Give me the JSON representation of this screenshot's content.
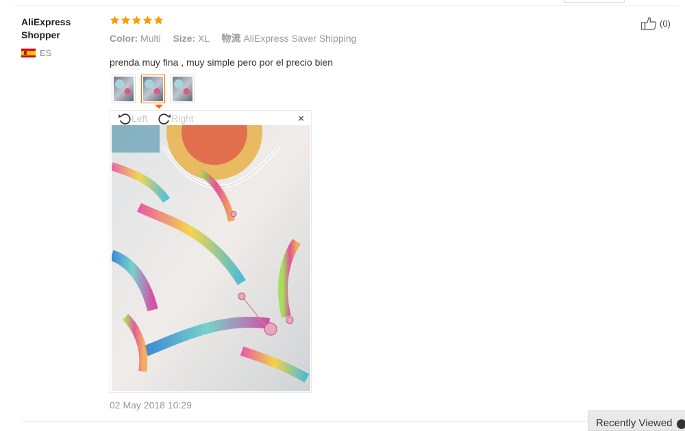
{
  "review": {
    "user_name": "AliExpress Shopper",
    "country_code": "ES",
    "rating": 5,
    "color_label": "Color:",
    "color_value": "Multi",
    "size_label": "Size:",
    "size_value": "XL",
    "shipping_label": "物流",
    "shipping_value": "AliExpress Saver Shipping",
    "text": "prenda muy fina , muy simple pero por el precio bien",
    "date": "02 May 2018 10:29",
    "helpful_count": "(0)"
  },
  "viewer": {
    "rotate_left": "Left",
    "rotate_right": "Right",
    "close": "×",
    "thumbnails": [
      "photo-1",
      "photo-2",
      "photo-3"
    ],
    "selected_index": 1
  },
  "recently_viewed": {
    "label": "Recently Viewed"
  },
  "colors": {
    "accent": "#ff6600",
    "star": "#ff9900",
    "muted": "#999999"
  }
}
